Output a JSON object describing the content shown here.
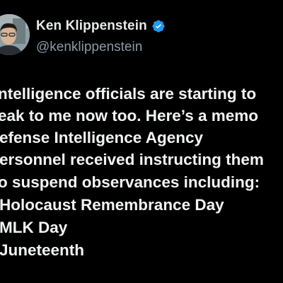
{
  "author": {
    "display_name": "Ken Klippenstein",
    "handle": "@kenklippenstein",
    "verified_icon": "verified-badge-icon",
    "verified_color": "#1d9bf0"
  },
  "tweet": {
    "lines": [
      "ntelligence officials are starting to",
      "eak to me now too. Here’s a memo",
      "efense Intelligence Agency",
      "ersonnel received instructing them",
      "o suspend observances including:",
      "Holocaust Remembrance Day",
      "MLK Day",
      "Juneteenth"
    ]
  }
}
